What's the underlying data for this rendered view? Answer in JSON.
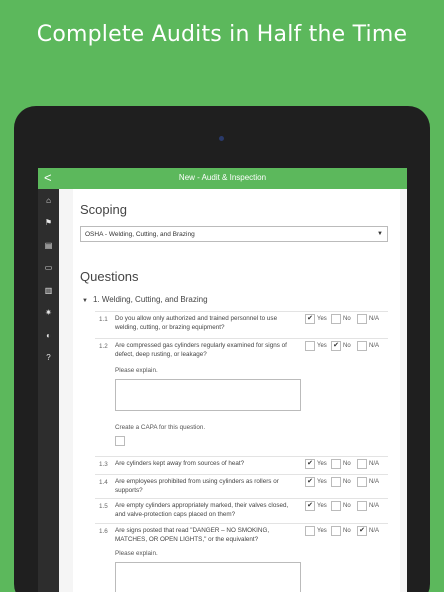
{
  "headline": "Complete Audits in Half the Time",
  "app": {
    "title": "New - Audit & Inspection",
    "back_label": "<"
  },
  "sidebar": {
    "items": [
      {
        "icon": "home-icon",
        "glyph": "⌂"
      },
      {
        "icon": "flag-icon",
        "glyph": "⚑"
      },
      {
        "icon": "document-icon",
        "glyph": "▤"
      },
      {
        "icon": "folder-icon",
        "glyph": "▭"
      },
      {
        "icon": "chart-icon",
        "glyph": "▥"
      },
      {
        "icon": "gear-icon",
        "glyph": "✷"
      },
      {
        "icon": "toggle-icon",
        "glyph": "◐"
      },
      {
        "icon": "help-icon",
        "glyph": "?"
      }
    ]
  },
  "scoping": {
    "heading": "Scoping",
    "selected": "OSHA - Welding, Cutting, and Brazing",
    "arrow": "▼"
  },
  "questions": {
    "heading": "Questions",
    "section": {
      "caret": "▼",
      "title": "1. Welding, Cutting, and Brazing"
    },
    "labels": {
      "yes": "Yes",
      "no": "No",
      "na": "N/A",
      "explain": "Please explain.",
      "capa": "Create a CAPA for this question."
    },
    "items": [
      {
        "num": "1.1",
        "text": "Do you allow only authorized and trained personnel to use welding, cutting, or brazing equipment?",
        "yes": "✔",
        "no": "",
        "na": ""
      },
      {
        "num": "1.2",
        "text": "Are compressed gas cylinders regularly examined for signs of defect, deep rusting, or leakage?",
        "yes": "",
        "no": "✔",
        "na": ""
      },
      {
        "num": "1.3",
        "text": "Are cylinders kept away from sources of heat?",
        "yes": "✔",
        "no": "",
        "na": ""
      },
      {
        "num": "1.4",
        "text": "Are employees prohibited from using cylinders as rollers or supports?",
        "yes": "✔",
        "no": "",
        "na": ""
      },
      {
        "num": "1.5",
        "text": "Are empty cylinders appropriately marked, their valves closed, and valve-protection caps placed on them?",
        "yes": "✔",
        "no": "",
        "na": ""
      },
      {
        "num": "1.6",
        "text": "Are signs posted that read \"DANGER – NO SMOKING, MATCHES, OR OPEN LIGHTS,\" or the equivalent?",
        "yes": "",
        "no": "",
        "na": "✔"
      }
    ]
  },
  "colors": {
    "brand": "#5cb85c",
    "sidebar": "#2d2d2d"
  }
}
